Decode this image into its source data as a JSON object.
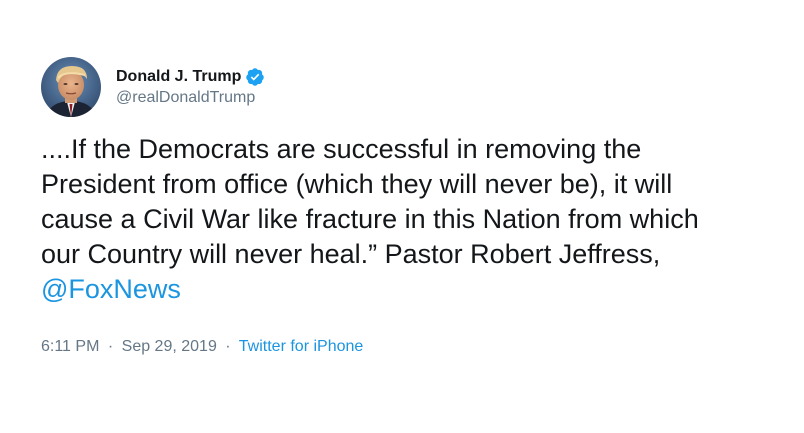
{
  "user": {
    "display_name": "Donald J. Trump",
    "handle": "@realDonaldTrump",
    "verified": true,
    "avatar_icon": "profile-photo",
    "verified_icon": "verified-badge-icon"
  },
  "tweet": {
    "lines": [
      "....If the Democrats are successful in removing the",
      "President from office (which they will never be), it will",
      "cause a Civil War like fracture in this Nation from which",
      "our Country will never heal.” Pastor Robert Jeffress,"
    ],
    "mention": "@FoxNews"
  },
  "meta": {
    "time": "6:11 PM",
    "separator": "·",
    "date": "Sep 29, 2019",
    "source": "Twitter for iPhone"
  },
  "colors": {
    "text": "#14171a",
    "secondary": "#657786",
    "link": "#1b95e0",
    "verified": "#1da1f2"
  }
}
